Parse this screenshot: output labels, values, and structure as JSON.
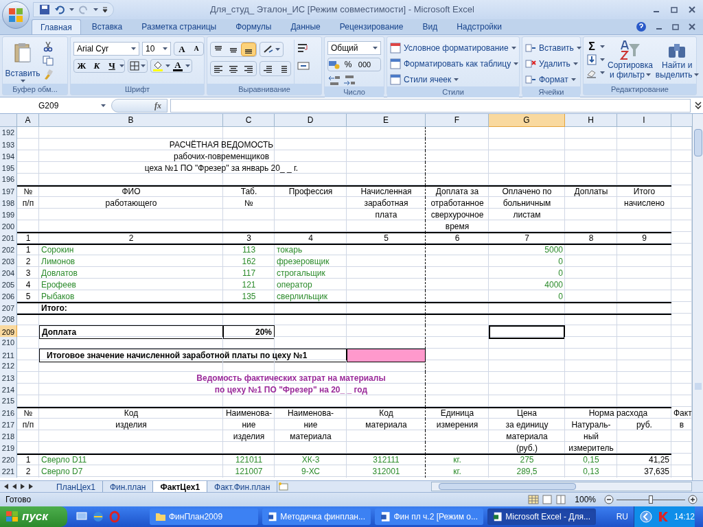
{
  "window": {
    "title": "Для_студ_ Эталон_ИС  [Режим совместимости] - Microsoft Excel"
  },
  "tabs": [
    {
      "label": "Главная",
      "selected": true
    },
    {
      "label": "Вставка",
      "selected": false
    },
    {
      "label": "Разметка страницы",
      "selected": false
    },
    {
      "label": "Формулы",
      "selected": false
    },
    {
      "label": "Данные",
      "selected": false
    },
    {
      "label": "Рецензирование",
      "selected": false
    },
    {
      "label": "Вид",
      "selected": false
    },
    {
      "label": "Надстройки",
      "selected": false
    }
  ],
  "ribbon": {
    "groups": [
      {
        "kind": "clipboard",
        "name": "Буфер обм...",
        "paste": "Вставить"
      },
      {
        "kind": "font",
        "name": "Шрифт",
        "font": "Arial Cyr",
        "size": "10",
        "grow": "A",
        "shrink": "A",
        "bold": "Ж",
        "italic": "К",
        "underline": "Ч",
        "font_color": "A"
      },
      {
        "kind": "alignment",
        "name": "Выравнивание",
        "vertical": [
          {
            "selected": false
          },
          {
            "selected": false
          },
          {
            "selected": true
          }
        ]
      },
      {
        "kind": "number",
        "name": "Число",
        "format": "Общий",
        "percent": "%",
        "thousands": "000"
      },
      {
        "kind": "styles",
        "name": "Стили",
        "items": [
          "Условное форматирование",
          "Форматировать как таблицу",
          "Стили ячеек"
        ]
      },
      {
        "kind": "cells",
        "name": "Ячейки",
        "items": [
          "Вставить",
          "Удалить",
          "Формат"
        ]
      },
      {
        "kind": "editing",
        "name": "Редактирование",
        "sum": "Σ",
        "sort": [
          "Сортировка",
          "и фильтр"
        ],
        "find": [
          "Найти и",
          "выделить"
        ]
      }
    ]
  },
  "formula_bar": {
    "name_box": "G209",
    "function_label": "fx"
  },
  "sheet": {
    "columns": [
      {
        "label": "A",
        "selected": false
      },
      {
        "label": "B",
        "selected": false
      },
      {
        "label": "C",
        "selected": false
      },
      {
        "label": "D",
        "selected": false
      },
      {
        "label": "E",
        "selected": false
      },
      {
        "label": "F",
        "selected": false
      },
      {
        "label": "G",
        "selected": true
      },
      {
        "label": "H",
        "selected": false
      },
      {
        "label": "I",
        "selected": false
      }
    ],
    "rows": [
      {
        "num": "192",
        "kind": "blank",
        "selected": false,
        "top_rule": false
      },
      {
        "num": "193",
        "kind": "heading",
        "selected": false,
        "top_rule": false,
        "cells": [
          "РАСЧЁТНАЯ ВЕДОМОСТЬ"
        ]
      },
      {
        "num": "194",
        "kind": "heading",
        "selected": false,
        "top_rule": false,
        "cells": [
          "рабочих-повременщиков"
        ]
      },
      {
        "num": "195",
        "kind": "heading",
        "selected": false,
        "top_rule": false,
        "cells": [
          "цеха №1 ПО \"Фрезер\" за январь 20_ _  г."
        ]
      },
      {
        "num": "196",
        "kind": "blank",
        "selected": false,
        "top_rule": false
      },
      {
        "num": "197",
        "kind": "header",
        "selected": false,
        "top_rule": true,
        "cells": [
          "№",
          "ФИО",
          "Таб.",
          "Профессия",
          "Начисленная",
          "Доплата за",
          "Оплачено по",
          "Доплаты",
          "Итого"
        ]
      },
      {
        "num": "198",
        "kind": "header",
        "selected": false,
        "top_rule": false,
        "cells": [
          "п/п",
          "работающего",
          "№",
          "",
          "заработная",
          "отработанное",
          "больничным",
          "",
          "начислено"
        ]
      },
      {
        "num": "199",
        "kind": "header",
        "selected": false,
        "top_rule": false,
        "cells": [
          "",
          "",
          "",
          "",
          "плата",
          "сверхурочное",
          "листам"
        ]
      },
      {
        "num": "200",
        "kind": "header",
        "selected": false,
        "top_rule": false,
        "cells": [
          "",
          "",
          "",
          "",
          "",
          "время"
        ]
      },
      {
        "num": "201",
        "kind": "header",
        "selected": false,
        "top_rule": true,
        "cells": [
          "1",
          "2",
          "3",
          "4",
          "5",
          "6",
          "7",
          "8",
          "9"
        ]
      },
      {
        "num": "202",
        "kind": "data",
        "selected": false,
        "top_rule": true,
        "cells": [
          "1",
          "Сорокин",
          "113",
          "токарь",
          "",
          "",
          "5000"
        ]
      },
      {
        "num": "203",
        "kind": "data",
        "selected": false,
        "top_rule": false,
        "cells": [
          "2",
          "Лимонов",
          "162",
          "фрезеровщик",
          "",
          "",
          "0"
        ]
      },
      {
        "num": "204",
        "kind": "data",
        "selected": false,
        "top_rule": false,
        "cells": [
          "3",
          "Довлатов",
          "117",
          "строгальщик",
          "",
          "",
          "0"
        ]
      },
      {
        "num": "205",
        "kind": "data",
        "selected": false,
        "top_rule": false,
        "cells": [
          "4",
          "Ерофеев",
          "121",
          "оператор",
          "",
          "",
          "4000"
        ]
      },
      {
        "num": "206",
        "kind": "data",
        "selected": false,
        "top_rule": false,
        "cells": [
          "5",
          "Рыбаков",
          "135",
          "сверлильщик",
          "",
          "",
          "0"
        ]
      },
      {
        "num": "207",
        "kind": "total",
        "selected": false,
        "top_rule": true,
        "cells": [
          "",
          "Итого:"
        ]
      },
      {
        "num": "208",
        "kind": "blank",
        "selected": false,
        "top_rule": true
      },
      {
        "num": "209",
        "kind": "rate",
        "selected": true,
        "top_rule": false,
        "cells": [
          "",
          "Доплата",
          "20%"
        ]
      },
      {
        "num": "210",
        "kind": "blank",
        "selected": false,
        "top_rule": false
      },
      {
        "num": "211",
        "kind": "summary",
        "selected": false,
        "top_rule": false,
        "cells": [
          "",
          "Итоговое значение начисленной заработной платы по цеху №1"
        ]
      },
      {
        "num": "212",
        "kind": "blank",
        "selected": false,
        "top_rule": false
      },
      {
        "num": "213",
        "kind": "title",
        "selected": false,
        "top_rule": false,
        "cells": [
          "Ведомость фактических затрат на материалы"
        ]
      },
      {
        "num": "214",
        "kind": "title",
        "selected": false,
        "top_rule": false,
        "cells": [
          "по цеху №1 ПО \"Фрезер\" на 20_ _  год"
        ]
      },
      {
        "num": "215",
        "kind": "blank",
        "selected": false,
        "top_rule": false
      },
      {
        "num": "216",
        "kind": "material-header",
        "selected": false,
        "top_rule": true,
        "cells": [
          "№",
          "Код",
          "Наименова-",
          "Наименова-",
          "Код",
          "Единица",
          "Цена",
          "Норма расхода",
          "",
          "Факт"
        ]
      },
      {
        "num": "217",
        "kind": "header",
        "selected": false,
        "top_rule": false,
        "cells": [
          "п/п",
          "изделия",
          "ние",
          "ние",
          "материала",
          "измерения",
          "за единицу",
          "Натураль-",
          "руб.",
          "в"
        ]
      },
      {
        "num": "218",
        "kind": "header",
        "selected": false,
        "top_rule": false,
        "cells": [
          "",
          "",
          "изделия",
          "материала",
          "",
          "",
          "материала",
          "ный"
        ]
      },
      {
        "num": "219",
        "kind": "header",
        "selected": false,
        "top_rule": false,
        "cells": [
          "",
          "",
          "",
          "",
          "",
          "",
          "(руб.)",
          "измеритель"
        ]
      },
      {
        "num": "220",
        "kind": "material",
        "selected": false,
        "top_rule": true,
        "cells": [
          "1",
          "Сверло D11",
          "121011",
          "ХК-3",
          "312111",
          "кг.",
          "275",
          "0,15",
          "41,25"
        ]
      },
      {
        "num": "221",
        "kind": "material",
        "selected": false,
        "top_rule": false,
        "cells": [
          "2",
          "Сверло D7",
          "121007",
          "9-ХС",
          "312001",
          "кг.",
          "289,5",
          "0,13",
          "37,635"
        ]
      }
    ]
  },
  "sheet_tabs": [
    {
      "label": "ПланЦех1",
      "selected": false
    },
    {
      "label": "Фин.план",
      "selected": false
    },
    {
      "label": "ФактЦех1",
      "selected": true
    },
    {
      "label": "Факт.Фин.план",
      "selected": false
    }
  ],
  "status_bar": {
    "text": "Готово",
    "zoom": "100%",
    "level": 0.5
  },
  "taskbar": {
    "start": "пуск",
    "items": [
      {
        "label": "ФинПлан2009",
        "kind": "folder",
        "selected": false
      },
      {
        "label": "Методичка финплан...",
        "kind": "word",
        "selected": false
      },
      {
        "label": "Фин пл ч.2 [Режим о...",
        "kind": "word",
        "selected": false
      },
      {
        "label": "Microsoft Excel - Для...",
        "kind": "excel",
        "selected": true
      }
    ],
    "language": "RU",
    "clock": "14:12"
  }
}
